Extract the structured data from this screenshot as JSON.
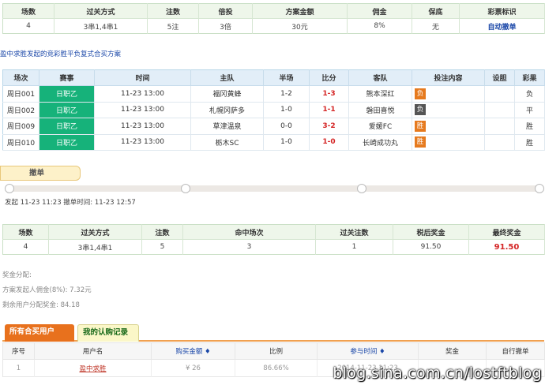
{
  "summary": {
    "headers": [
      "场数",
      "过关方式",
      "注数",
      "倍投",
      "方案金额",
      "佣金",
      "保底",
      "彩票标识"
    ],
    "row": [
      "4",
      "3串1,4串1",
      "5注",
      "3倍",
      "30元",
      "8%",
      "无",
      "自动撤单"
    ]
  },
  "section_title": "盈中求胜发起的竞彩胜平负复式合买方案",
  "matches": {
    "headers": [
      "场次",
      "赛事",
      "时间",
      "主队",
      "半场",
      "比分",
      "客队",
      "投注内容",
      "设胆",
      "彩果"
    ],
    "rows": [
      {
        "id": "周日001",
        "league": "日职乙",
        "time": "11-23 13:00",
        "home": "福冈黄蜂",
        "half": "1-2",
        "score": "1-3",
        "away": "熊本深红",
        "pick": "负",
        "banker": "",
        "result": "负"
      },
      {
        "id": "周日002",
        "league": "日职乙",
        "time": "11-23 13:00",
        "home": "札幌冈萨多",
        "half": "1-0",
        "score": "1-1",
        "away": "磐田喜悦",
        "pick": "负",
        "banker": "",
        "result": "平"
      },
      {
        "id": "周日009",
        "league": "日职乙",
        "time": "11-23 13:00",
        "home": "草津温泉",
        "half": "0-0",
        "score": "3-2",
        "away": "爱媛FC",
        "pick": "胜",
        "banker": "",
        "result": "胜"
      },
      {
        "id": "周日010",
        "league": "日职乙",
        "time": "11-23 13:00",
        "home": "栃木SC",
        "half": "1-0",
        "score": "1-0",
        "away": "长崎成功丸",
        "pick": "胜",
        "banker": "",
        "result": "胜"
      }
    ]
  },
  "progress": {
    "stage_label": "撤单",
    "text": "发起 11-23 11:23 撤单时间: 11-23 12:57"
  },
  "result": {
    "headers": [
      "场数",
      "过关方式",
      "注数",
      "命中场次",
      "过关注数",
      "税后奖金",
      "最终奖金"
    ],
    "row": [
      "4",
      "3串1,4串1",
      "5",
      "3",
      "1",
      "91.50",
      "91.50"
    ]
  },
  "prize": {
    "line1": "奖金分配:",
    "line2": "方案发起人佣金(8%): 7.32元",
    "line3": "剩余用户分配奖金: 84.18"
  },
  "tabs": {
    "active": "所有合买用户",
    "inactive": "我的认购记录"
  },
  "buyers": {
    "headers": [
      "序号",
      "用户名",
      "购买金额",
      "比例",
      "参与时间",
      "奖金",
      "自行撤单"
    ],
    "sort_marker": "♦",
    "rows": [
      {
        "no": "1",
        "user": "盈中求胜",
        "amount": "¥ 26",
        "ratio": "86.66%",
        "time": "2014-11-23 11:23",
        "prize": "",
        "cancel": ""
      }
    ]
  },
  "watermark": "blog.sina.com.cn/lostftblog",
  "colors": {
    "accent_orange": "#e8711d",
    "league_green": "#16b27a",
    "score_red": "#d42424",
    "link_blue": "#1a47a8"
  }
}
